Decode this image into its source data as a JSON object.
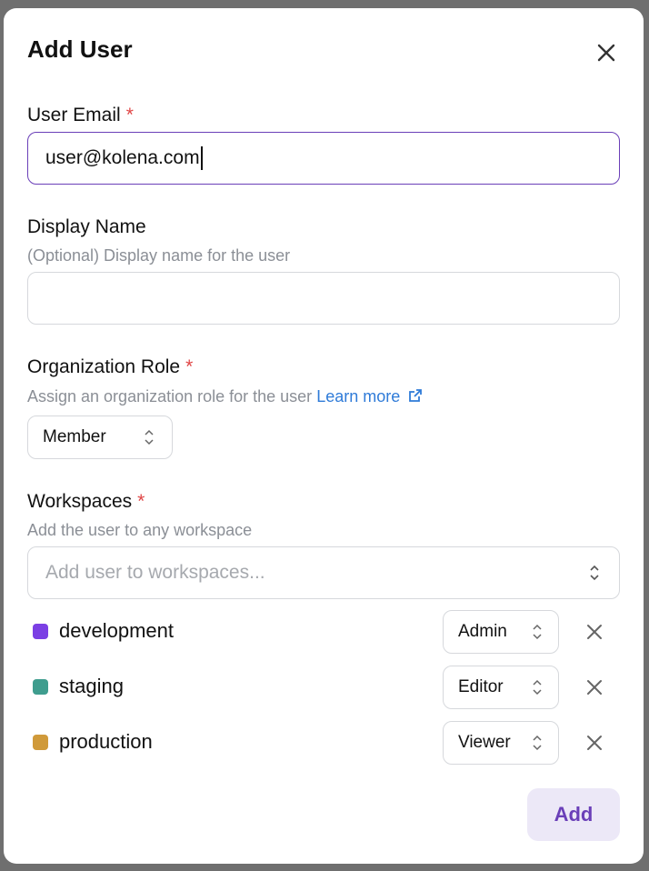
{
  "dialog": {
    "title": "Add User"
  },
  "email": {
    "label": "User Email",
    "required_mark": "*",
    "value": "user@kolena.com"
  },
  "display_name": {
    "label": "Display Name",
    "hint": "(Optional) Display name for the user",
    "value": ""
  },
  "org_role": {
    "label": "Organization Role",
    "required_mark": "*",
    "hint": "Assign an organization role for the user",
    "link": "Learn more",
    "selected": "Member"
  },
  "workspaces": {
    "label": "Workspaces",
    "required_mark": "*",
    "hint": "Add the user to any workspace",
    "placeholder": "Add user to workspaces...",
    "items": [
      {
        "name": "development",
        "role": "Admin",
        "color": "#7b3fe4"
      },
      {
        "name": "staging",
        "role": "Editor",
        "color": "#3f9d8e"
      },
      {
        "name": "production",
        "role": "Viewer",
        "color": "#d09a3a"
      }
    ]
  },
  "footer": {
    "add_label": "Add"
  },
  "icons": {
    "close": "close-icon",
    "external_link": "external-link-icon",
    "select_arrows": "chevron-up-down-icon",
    "remove": "close-icon"
  },
  "colors": {
    "accent": "#6a3fb8",
    "required": "#e04646",
    "link": "#2f7bd8"
  }
}
